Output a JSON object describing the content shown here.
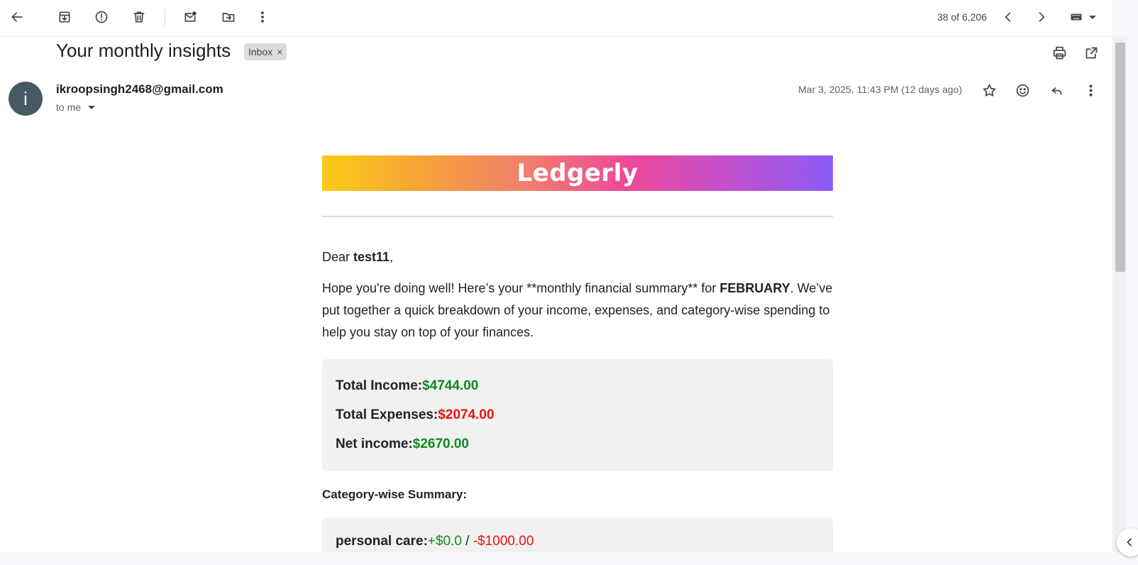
{
  "toolbar": {
    "pager": "38 of 6,206"
  },
  "message": {
    "subject": "Your monthly insights",
    "label": "Inbox",
    "label_remove": "×",
    "avatar_initial": "i",
    "sender": "ikroopsingh2468@gmail.com",
    "recipient": "to me",
    "datetime": "Mar 3, 2025, 11:43 PM (12 days ago)"
  },
  "email": {
    "brand": "Ledgerly",
    "greeting_prefix": "Dear ",
    "username": "test11",
    "greeting_suffix": ",",
    "intro_part1": "Hope you're doing well! Here’s your **monthly financial summary** for ",
    "month": "FEBRUARY",
    "intro_part2": ". We’ve put together a quick breakdown of your income, expenses, and category-wise spending to help you stay on top of your finances.",
    "summary": {
      "income_label": "Total Income:",
      "income_value": "$4744.00",
      "expenses_label": "Total Expenses:",
      "expenses_value": "$2074.00",
      "net_label": "Net income:",
      "net_value": "$2670.00"
    },
    "category_title": "Category-wise Summary:",
    "categories": [
      {
        "name": "personal care:",
        "income": "+$0.0",
        "sep": " / ",
        "expense": "-$1000.00"
      }
    ]
  },
  "icons": {
    "back": "arrow-left-icon",
    "archive": "archive-icon",
    "spam": "report-spam-icon",
    "delete": "trash-icon",
    "unread": "mark-unread-icon",
    "move": "move-to-folder-icon",
    "more": "more-vert-icon",
    "prev": "chevron-left-icon",
    "next": "chevron-right-icon",
    "keyboard": "keyboard-icon",
    "print": "print-icon",
    "popout": "open-in-new-icon",
    "star": "star-icon",
    "emoji": "emoji-icon",
    "reply": "reply-icon"
  },
  "colors": {
    "positive": "#0f8a1e",
    "negative": "#e8120c",
    "avatar": "#455a64"
  }
}
